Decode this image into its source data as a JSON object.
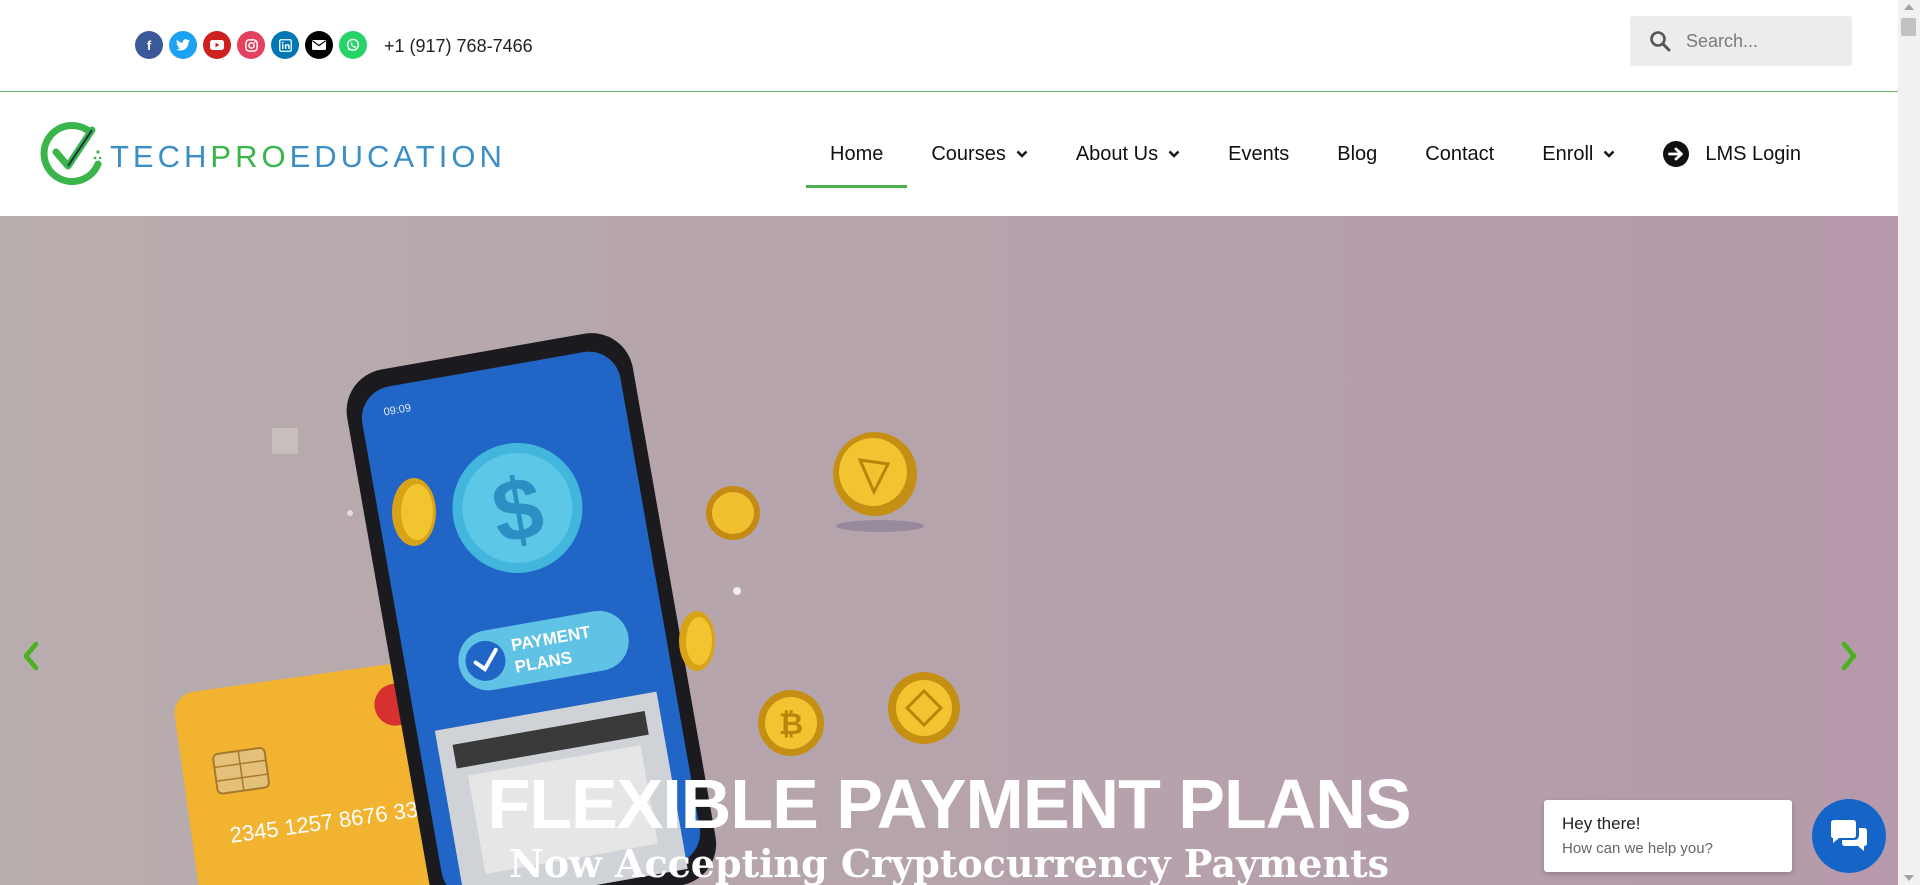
{
  "topbar": {
    "socials": [
      {
        "icon": "facebook-icon",
        "glyph": "f",
        "color": "#3b5998"
      },
      {
        "icon": "twitter-icon",
        "glyph": "t",
        "color": "#1da1f2"
      },
      {
        "icon": "youtube-icon",
        "glyph": "▶",
        "color": "#cd201f"
      },
      {
        "icon": "instagram-icon",
        "glyph": "◎",
        "color": "#e4405f"
      },
      {
        "icon": "linkedin-icon",
        "glyph": "in",
        "color": "#0077b5"
      },
      {
        "icon": "envelope-icon",
        "glyph": "✉",
        "color": "#000000"
      },
      {
        "icon": "whatsapp-icon",
        "glyph": "✆",
        "color": "#25d366"
      }
    ],
    "phone": "+1 (917) 768-7466"
  },
  "search": {
    "placeholder": "Search..."
  },
  "logo": {
    "part1": "TECH",
    "part2": "PRO",
    "part3": "EDUCATION",
    "accent_blue": "#3b8ec6",
    "accent_green": "#39b54a"
  },
  "nav": {
    "items": [
      {
        "label": "Home",
        "active": true,
        "dropdown": false
      },
      {
        "label": "Courses",
        "dropdown": true
      },
      {
        "label": "About Us",
        "dropdown": true
      },
      {
        "label": "Events",
        "dropdown": false
      },
      {
        "label": "Blog",
        "dropdown": false
      },
      {
        "label": "Contact",
        "dropdown": false
      },
      {
        "label": "Enroll",
        "dropdown": true
      }
    ],
    "lms_label": "LMS Login"
  },
  "hero": {
    "title": "FLEXIBLE PAYMENT PLANS",
    "subtitle": "Now Accepting Cryptocurrency Payments",
    "phone_badge": "PAYMENT PLANS",
    "badge_line1": "PAYMENT",
    "badge_line2": "PLANS",
    "card_number": "2345 1257 8676 334",
    "status_time": "09:09",
    "arrow_color": "#4caf1e"
  },
  "chat": {
    "line1": "Hey there!",
    "line2": "How can we help you?"
  }
}
